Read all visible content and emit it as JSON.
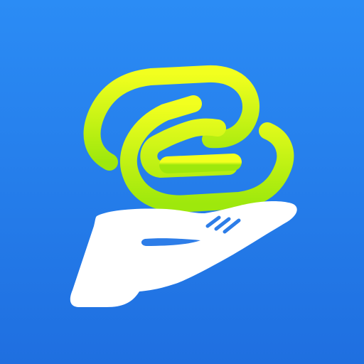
{
  "colors": {
    "background_top": "#2b8cf5",
    "background_bottom": "#1f6fe0",
    "link_light": "#f2ff1f",
    "link_dark": "#9ee80c",
    "hand": "#ffffff",
    "finger_gap": "#2d7de8"
  },
  "icons": {
    "app": "app-icon",
    "link": "chain-link-icon",
    "hand": "open-hand-icon"
  }
}
